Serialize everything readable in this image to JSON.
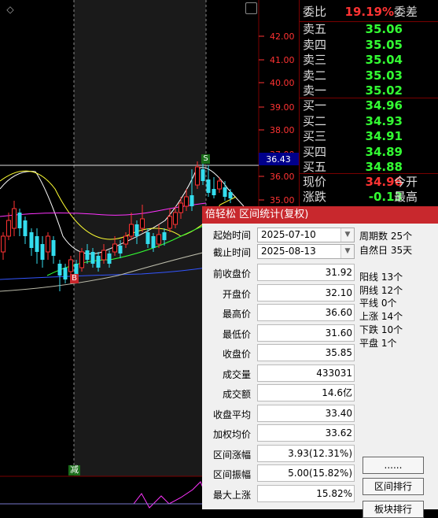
{
  "chart": {
    "price_axis": [
      "42.00",
      "41.00",
      "40.00",
      "39.00",
      "38.00",
      "37.00",
      "36.00",
      "35.00"
    ],
    "current_price_tag": "36.43",
    "markers": {
      "sell": "S",
      "buy": "B",
      "reduce": "减"
    },
    "colors": {
      "up": "#ff3333",
      "down": "#33ddee",
      "ma1": "#ffffff",
      "ma2": "#ffff33",
      "ma3": "#ff33ff",
      "ma4": "#33ff33",
      "ma5": "#3355ff",
      "ma6": "#bbbbaa"
    }
  },
  "orderbook": {
    "ratio": {
      "label": "委比",
      "value": "19.19%",
      "extra": "委差"
    },
    "asks": [
      {
        "label": "卖五",
        "price": "35.06"
      },
      {
        "label": "卖四",
        "price": "35.05"
      },
      {
        "label": "卖三",
        "price": "35.04"
      },
      {
        "label": "卖二",
        "price": "35.03"
      },
      {
        "label": "卖一",
        "price": "35.02"
      }
    ],
    "bids": [
      {
        "label": "买一",
        "price": "34.96"
      },
      {
        "label": "买二",
        "price": "34.93"
      },
      {
        "label": "买三",
        "price": "34.91"
      },
      {
        "label": "买四",
        "price": "34.89"
      },
      {
        "label": "买五",
        "price": "34.88"
      }
    ],
    "quote": {
      "current": {
        "label": "现价",
        "value": "34.96",
        "extra": "今开"
      },
      "change": {
        "label": "涨跌",
        "value": "-0.13",
        "extra": "最高"
      }
    }
  },
  "dialog": {
    "title": "倍轻松 区间统计(复权)",
    "start_label": "起始时间",
    "start_value": "2025-07-10",
    "end_label": "截止时间",
    "end_value": "2025-08-13",
    "fields": [
      {
        "label": "前收盘价",
        "value": "31.92"
      },
      {
        "label": "开盘价",
        "value": "32.10"
      },
      {
        "label": "最高价",
        "value": "36.60"
      },
      {
        "label": "最低价",
        "value": "31.60"
      },
      {
        "label": "收盘价",
        "value": "35.85"
      },
      {
        "label": "成交量",
        "value": "433031"
      },
      {
        "label": "成交额",
        "value": "14.6亿"
      },
      {
        "label": "收盘平均",
        "value": "33.40"
      },
      {
        "label": "加权均价",
        "value": "33.62"
      },
      {
        "label": "区间涨幅",
        "value": "3.93(12.31%)"
      },
      {
        "label": "区间振幅",
        "value": "5.00(15.82%)"
      },
      {
        "label": "最大上涨",
        "value": "15.82%"
      }
    ],
    "stats": [
      "周期数 25个",
      "自然日 35天",
      "阳线 13个",
      "阴线 12个",
      "平线 0个",
      "上涨 14个",
      "下跌 10个",
      "平盘 1个"
    ],
    "buttons": {
      "more": "......",
      "rank": "区间排行",
      "sector_rank": "板块排行"
    }
  }
}
